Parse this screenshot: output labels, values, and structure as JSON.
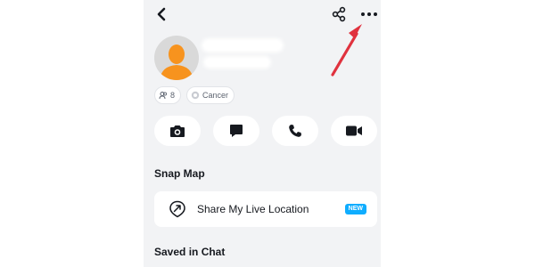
{
  "header": {
    "back_icon": "chevron-left-icon",
    "share_icon": "share-icon",
    "more_icon": "more-horizontal-icon"
  },
  "profile": {
    "avatar_icon": "bitmoji-placeholder-icon",
    "avatar_color": "#f7931e",
    "friends_count": "8",
    "zodiac": "Cancer"
  },
  "actions": [
    {
      "icon": "camera-icon"
    },
    {
      "icon": "chat-icon"
    },
    {
      "icon": "phone-icon"
    },
    {
      "icon": "video-icon"
    }
  ],
  "snap_map": {
    "title": "Snap Map",
    "share_location_label": "Share My Live Location",
    "badge": "NEW",
    "badge_color": "#0fadff"
  },
  "saved_in_chat": {
    "title": "Saved in Chat"
  },
  "annotation": {
    "arrow_color": "#e0323e"
  }
}
